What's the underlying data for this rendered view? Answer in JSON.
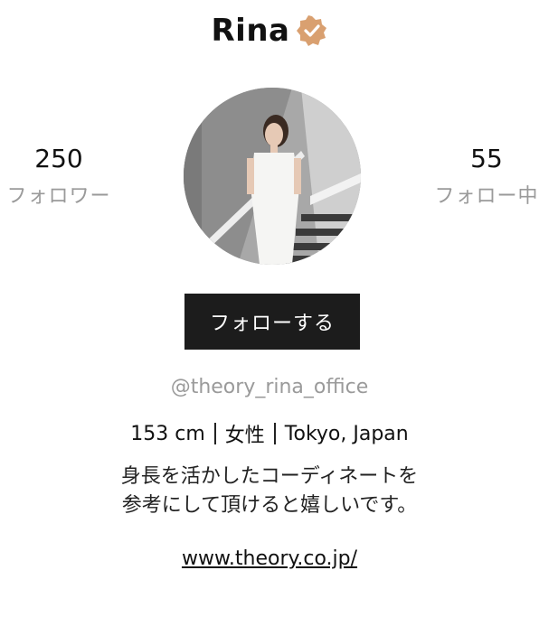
{
  "profile": {
    "name": "Rina",
    "verified_icon": "verified-badge-icon",
    "verified_color": "#d9a070",
    "followers_count": "250",
    "followers_label": "フォロワー",
    "following_count": "55",
    "following_label": "フォロー中",
    "follow_button_label": "フォローする",
    "handle": "@theory_rina_office",
    "height": "153 cm",
    "gender": "女性",
    "location": "Tokyo, Japan",
    "bio_line1": "身長を活かしたコーディネートを",
    "bio_line2": "参考にして頂けると嬉しいです。",
    "website": "www.theory.co.jp/"
  },
  "colors": {
    "button_bg": "#1c1c1c",
    "muted_text": "#9a9a9a"
  }
}
